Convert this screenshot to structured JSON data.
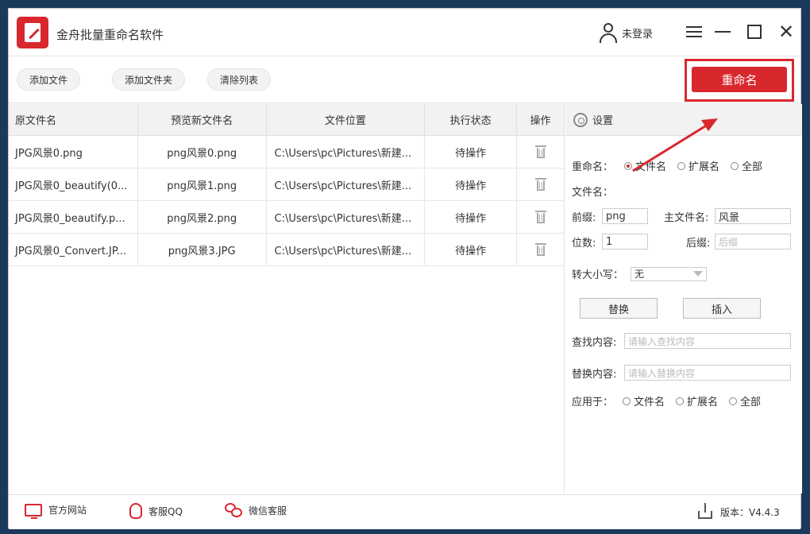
{
  "app": {
    "title": "金舟批量重命名软件",
    "user_label": "未登录"
  },
  "toolbar": {
    "add_file": "添加文件",
    "add_folder": "添加文件夹",
    "clear_list": "清除列表",
    "rename": "重命名"
  },
  "table": {
    "headers": [
      "原文件名",
      "预览新文件名",
      "文件位置",
      "执行状态",
      "操作"
    ],
    "rows": [
      {
        "original": "JPG风景0.png",
        "preview": "png风景0.png",
        "location": "C:\\Users\\pc\\Pictures\\新建...",
        "status": "待操作"
      },
      {
        "original": "JPG风景0_beautify(0...",
        "preview": "png风景1.png",
        "location": "C:\\Users\\pc\\Pictures\\新建...",
        "status": "待操作"
      },
      {
        "original": "JPG风景0_beautify.p...",
        "preview": "png风景2.png",
        "location": "C:\\Users\\pc\\Pictures\\新建...",
        "status": "待操作"
      },
      {
        "original": "JPG风景0_Convert.JP...",
        "preview": "png风景3.JPG",
        "location": "C:\\Users\\pc\\Pictures\\新建...",
        "status": "待操作"
      }
    ]
  },
  "settings": {
    "title": "设置",
    "rename_label": "重命名：",
    "rename_options": [
      "文件名",
      "扩展名",
      "全部"
    ],
    "rename_selected": "文件名",
    "filename_label": "文件名：",
    "prefix_label": "前缀:",
    "prefix_value": "png",
    "main_name_label": "主文件名:",
    "main_name_value": "风景",
    "digits_label": "位数:",
    "digits_value": "1",
    "suffix_label": "后缀:",
    "suffix_placeholder": "后缀",
    "case_label": "转大小写：",
    "case_value": "无",
    "replace_button": "替换",
    "insert_button": "插入",
    "find_label": "查找内容:",
    "find_placeholder": "请输入查找内容",
    "replace_label": "替换内容:",
    "replace_placeholder": "请输入替换内容",
    "apply_label": "应用于：",
    "apply_options": [
      "文件名",
      "扩展名",
      "全部"
    ]
  },
  "footer": {
    "website": "官方网站",
    "qq": "客服QQ",
    "wechat": "微信客服",
    "version": "版本：V4.4.3"
  },
  "colors": {
    "accent": "#d9272e",
    "header_bg": "#f2f2f2"
  }
}
